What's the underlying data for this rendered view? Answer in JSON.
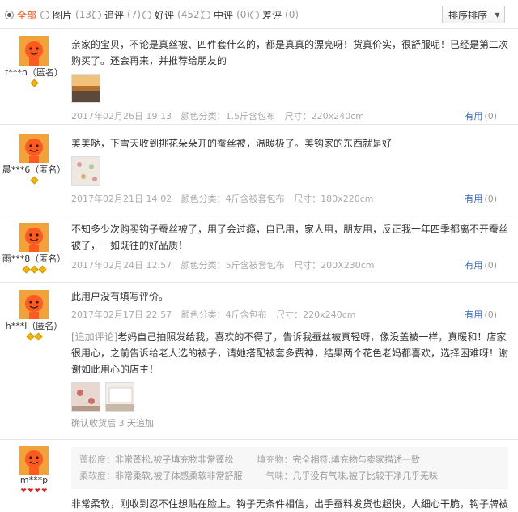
{
  "filters": [
    {
      "label": "全部",
      "count": "",
      "active": true
    },
    {
      "label": "图片",
      "count": "(13)",
      "active": false
    },
    {
      "label": "追评",
      "count": "(7)",
      "active": false
    },
    {
      "label": "好评",
      "count": "(452)",
      "active": false
    },
    {
      "label": "中评",
      "count": "(0)",
      "active": false
    },
    {
      "label": "差评",
      "count": "(0)",
      "active": false
    }
  ],
  "sort_label": "排序排序",
  "sort_caret": "▼",
  "colors": {
    "accent": "#ff4400",
    "link": "#3366cc",
    "level_gem": "#f5b400",
    "level_heart": "#e02020"
  },
  "reviews": [
    {
      "username": "t***h（匿名）",
      "level": "2 gems",
      "text": "亲家的宝贝，不论是真丝被、四件套什么的，都是真真的漂亮呀！货真价实，很舒服呢！已经是第二次购买了。还会再来，并推荐给朋友的",
      "date": "2017年02月26日 19:13",
      "color": "颜色分类：1.5斤含包布",
      "size": "尺寸：220x240cm",
      "useful_label": "有用",
      "useful_count": "(0)"
    },
    {
      "username": "晨***6（匿名）",
      "level": "1 gem",
      "text": "美美哒，下雪天收到挑花朵朵开的蚕丝被，温暖极了。美钩家的东西就是好",
      "date": "2017年02月21日 14:02",
      "color": "颜色分类：4斤含被套包布",
      "size": "尺寸：180x220cm",
      "useful_label": "有用",
      "useful_count": "(0)"
    },
    {
      "username": "雨***8（匿名）",
      "level": "3 gems",
      "text": "不知多少次购买钩子蚕丝被了，用了会过瘾，自已用，家人用，朋友用，反正我一年四季都离不开蚕丝被了，一如既往的好品质！",
      "date": "2017年02月24日 12:57",
      "color": "颜色分类：5斤含被套包布",
      "size": "尺寸：200X230cm",
      "useful_label": "有用",
      "useful_count": "(0)"
    },
    {
      "username": "h***l（匿名）",
      "level": "2 gems",
      "text": "此用户没有填写评价。",
      "date": "2017年02月17日 22:57",
      "color": "颜色分类：4斤含包布",
      "size": "尺寸：220x240cm",
      "useful_label": "有用",
      "useful_count": "(0)",
      "append_tag": "[追加评论]",
      "append_text": "老妈自己拍照发给我，喜欢的不得了，告诉我蚕丝被真轻呀，像没盖被一样，真暖和！店家很用心，之前告诉给老人选的被子，请她搭配被套多费神，结果两个花色老妈都喜欢，选择困难呀！谢谢如此用心的店主！",
      "append_note": "确认收货后 3 天追加"
    },
    {
      "username": "m***p",
      "level": "4 hearts",
      "params": [
        {
          "k": "蓬松度：",
          "v": "非常蓬松,被子填充物非常蓬松"
        },
        {
          "k": "填充物：",
          "v": "完全相符,填充物与卖家描述一致"
        },
        {
          "k": "柔软度：",
          "v": "非常柔软,被子体感柔软非常舒服"
        },
        {
          "k": "气味：",
          "v": "几乎没有气味,被子比较干净几乎无味"
        }
      ],
      "text": "非常柔软，刚收到忍不住想贴在脸上。钩子无条件相信，出手蚕料发货也超快，人细心干脆，钩子牌被心服下，回购送人！"
    }
  ]
}
